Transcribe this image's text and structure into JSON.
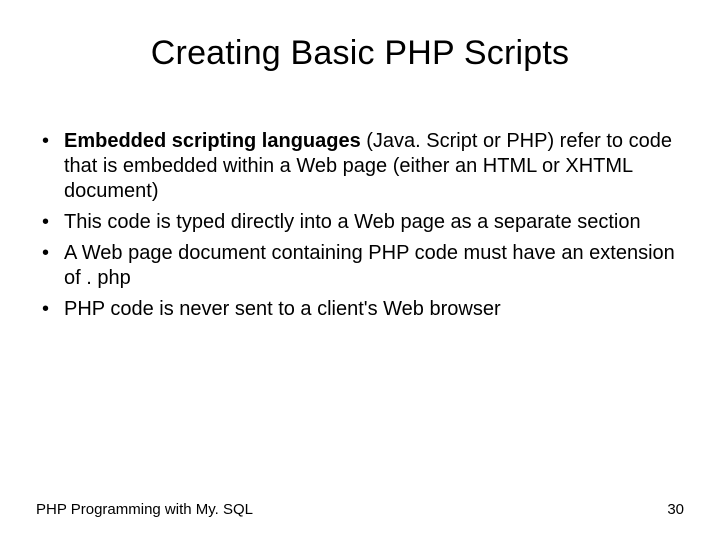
{
  "title": "Creating Basic PHP Scripts",
  "bullets": [
    {
      "bold": "Embedded scripting languages",
      "rest": " (Java. Script or PHP) refer to code that is embedded within a Web page (either an HTML or XHTML document)"
    },
    {
      "bold": "",
      "rest": "This code is typed directly into a Web page as a separate section"
    },
    {
      "bold": "",
      "rest": "A Web page document containing PHP code must have an extension of . php"
    },
    {
      "bold": "",
      "rest": "PHP code is never sent to a client's Web browser"
    }
  ],
  "footer": {
    "left": "PHP Programming with My. SQL",
    "right": "30"
  }
}
